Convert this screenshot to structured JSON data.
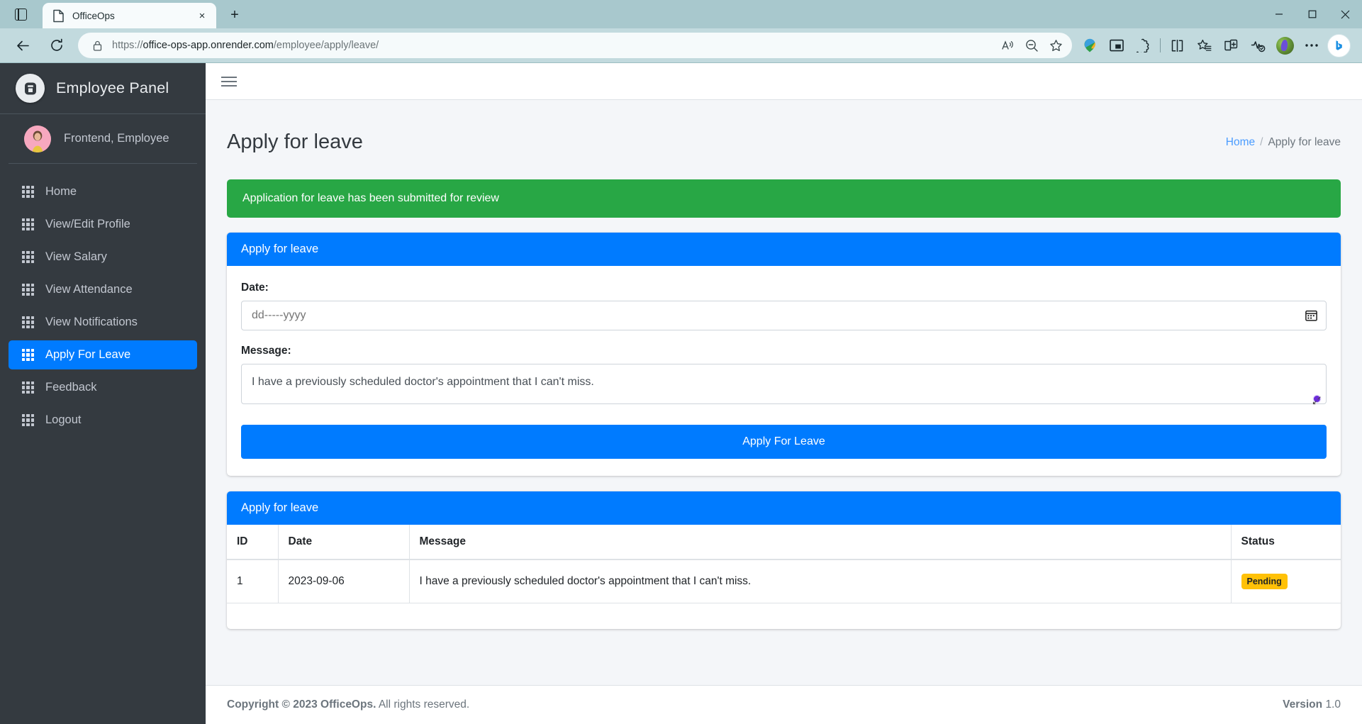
{
  "browser": {
    "tab_search_icon": "tab-search-icon",
    "tab": {
      "title": "OfficeOps",
      "favicon": "page-icon",
      "close": "×"
    },
    "new_tab": "+",
    "window_controls": {
      "minimize": "—",
      "maximize": "▢",
      "close": "✕"
    },
    "nav": {
      "back": "←",
      "reload": "⟳",
      "lock": "lock-icon"
    },
    "url": {
      "scheme": "https://",
      "host": "office-ops-app.onrender.com",
      "path": "/employee/apply/leave/"
    },
    "omnibox_actions": [
      "read-aloud-icon",
      "zoom-out-icon",
      "favorite-star-icon"
    ],
    "toolbar_icons": [
      "download-manager-icon",
      "picture-in-picture-icon",
      "extensions-icon",
      "split-screen-icon",
      "favorites-icon",
      "collections-icon",
      "browser-essentials-icon",
      "profile-avatar",
      "settings-more-icon",
      "copilot-icon"
    ]
  },
  "sidebar": {
    "brand": {
      "logo": "officeops-logo-icon",
      "title": "Employee Panel"
    },
    "user": {
      "avatar": "user-avatar",
      "name": "Frontend, Employee"
    },
    "items": [
      {
        "label": "Home",
        "icon": "grid-icon",
        "active": false
      },
      {
        "label": "View/Edit Profile",
        "icon": "grid-icon",
        "active": false
      },
      {
        "label": "View Salary",
        "icon": "grid-icon",
        "active": false
      },
      {
        "label": "View Attendance",
        "icon": "grid-icon",
        "active": false
      },
      {
        "label": "View Notifications",
        "icon": "grid-icon",
        "active": false
      },
      {
        "label": "Apply For Leave",
        "icon": "grid-icon",
        "active": true
      },
      {
        "label": "Feedback",
        "icon": "grid-icon",
        "active": false
      },
      {
        "label": "Logout",
        "icon": "grid-icon",
        "active": false
      }
    ]
  },
  "topnav": {
    "menu_toggle": "hamburger-icon"
  },
  "page": {
    "title": "Apply for leave",
    "breadcrumb": {
      "home": "Home",
      "separator": "/",
      "current": "Apply for leave"
    }
  },
  "alert": {
    "text": "Application for leave has been submitted for review",
    "color": "#28a745"
  },
  "form_card": {
    "header": "Apply for leave",
    "date_label": "Date:",
    "date_value": "",
    "date_placeholder": "dd-----yyyy",
    "calendar_icon": "calendar-icon",
    "message_label": "Message:",
    "message_value": "I have a previously scheduled doctor's appointment that I can't miss.",
    "message_placeholder": "",
    "submit_label": "Apply For Leave",
    "grammar_badge": "grammar-assistant-icon"
  },
  "table_card": {
    "header": "Apply for leave",
    "columns": [
      "ID",
      "Date",
      "Message",
      "Status"
    ],
    "rows": [
      {
        "id": "1",
        "date": "2023-09-06",
        "message": "I have a previously scheduled doctor's appointment that I can't miss.",
        "status": "Pending"
      }
    ]
  },
  "footer": {
    "copyright_strong": "Copyright © 2023 OfficeOps.",
    "copyright_rest": " All rights reserved.",
    "version_label": "Version",
    "version_value": "1.0"
  },
  "colors": {
    "primary": "#007bff",
    "success": "#28a745",
    "warning": "#ffc107",
    "sidebar": "#343a40",
    "body": "#f4f6f9"
  }
}
